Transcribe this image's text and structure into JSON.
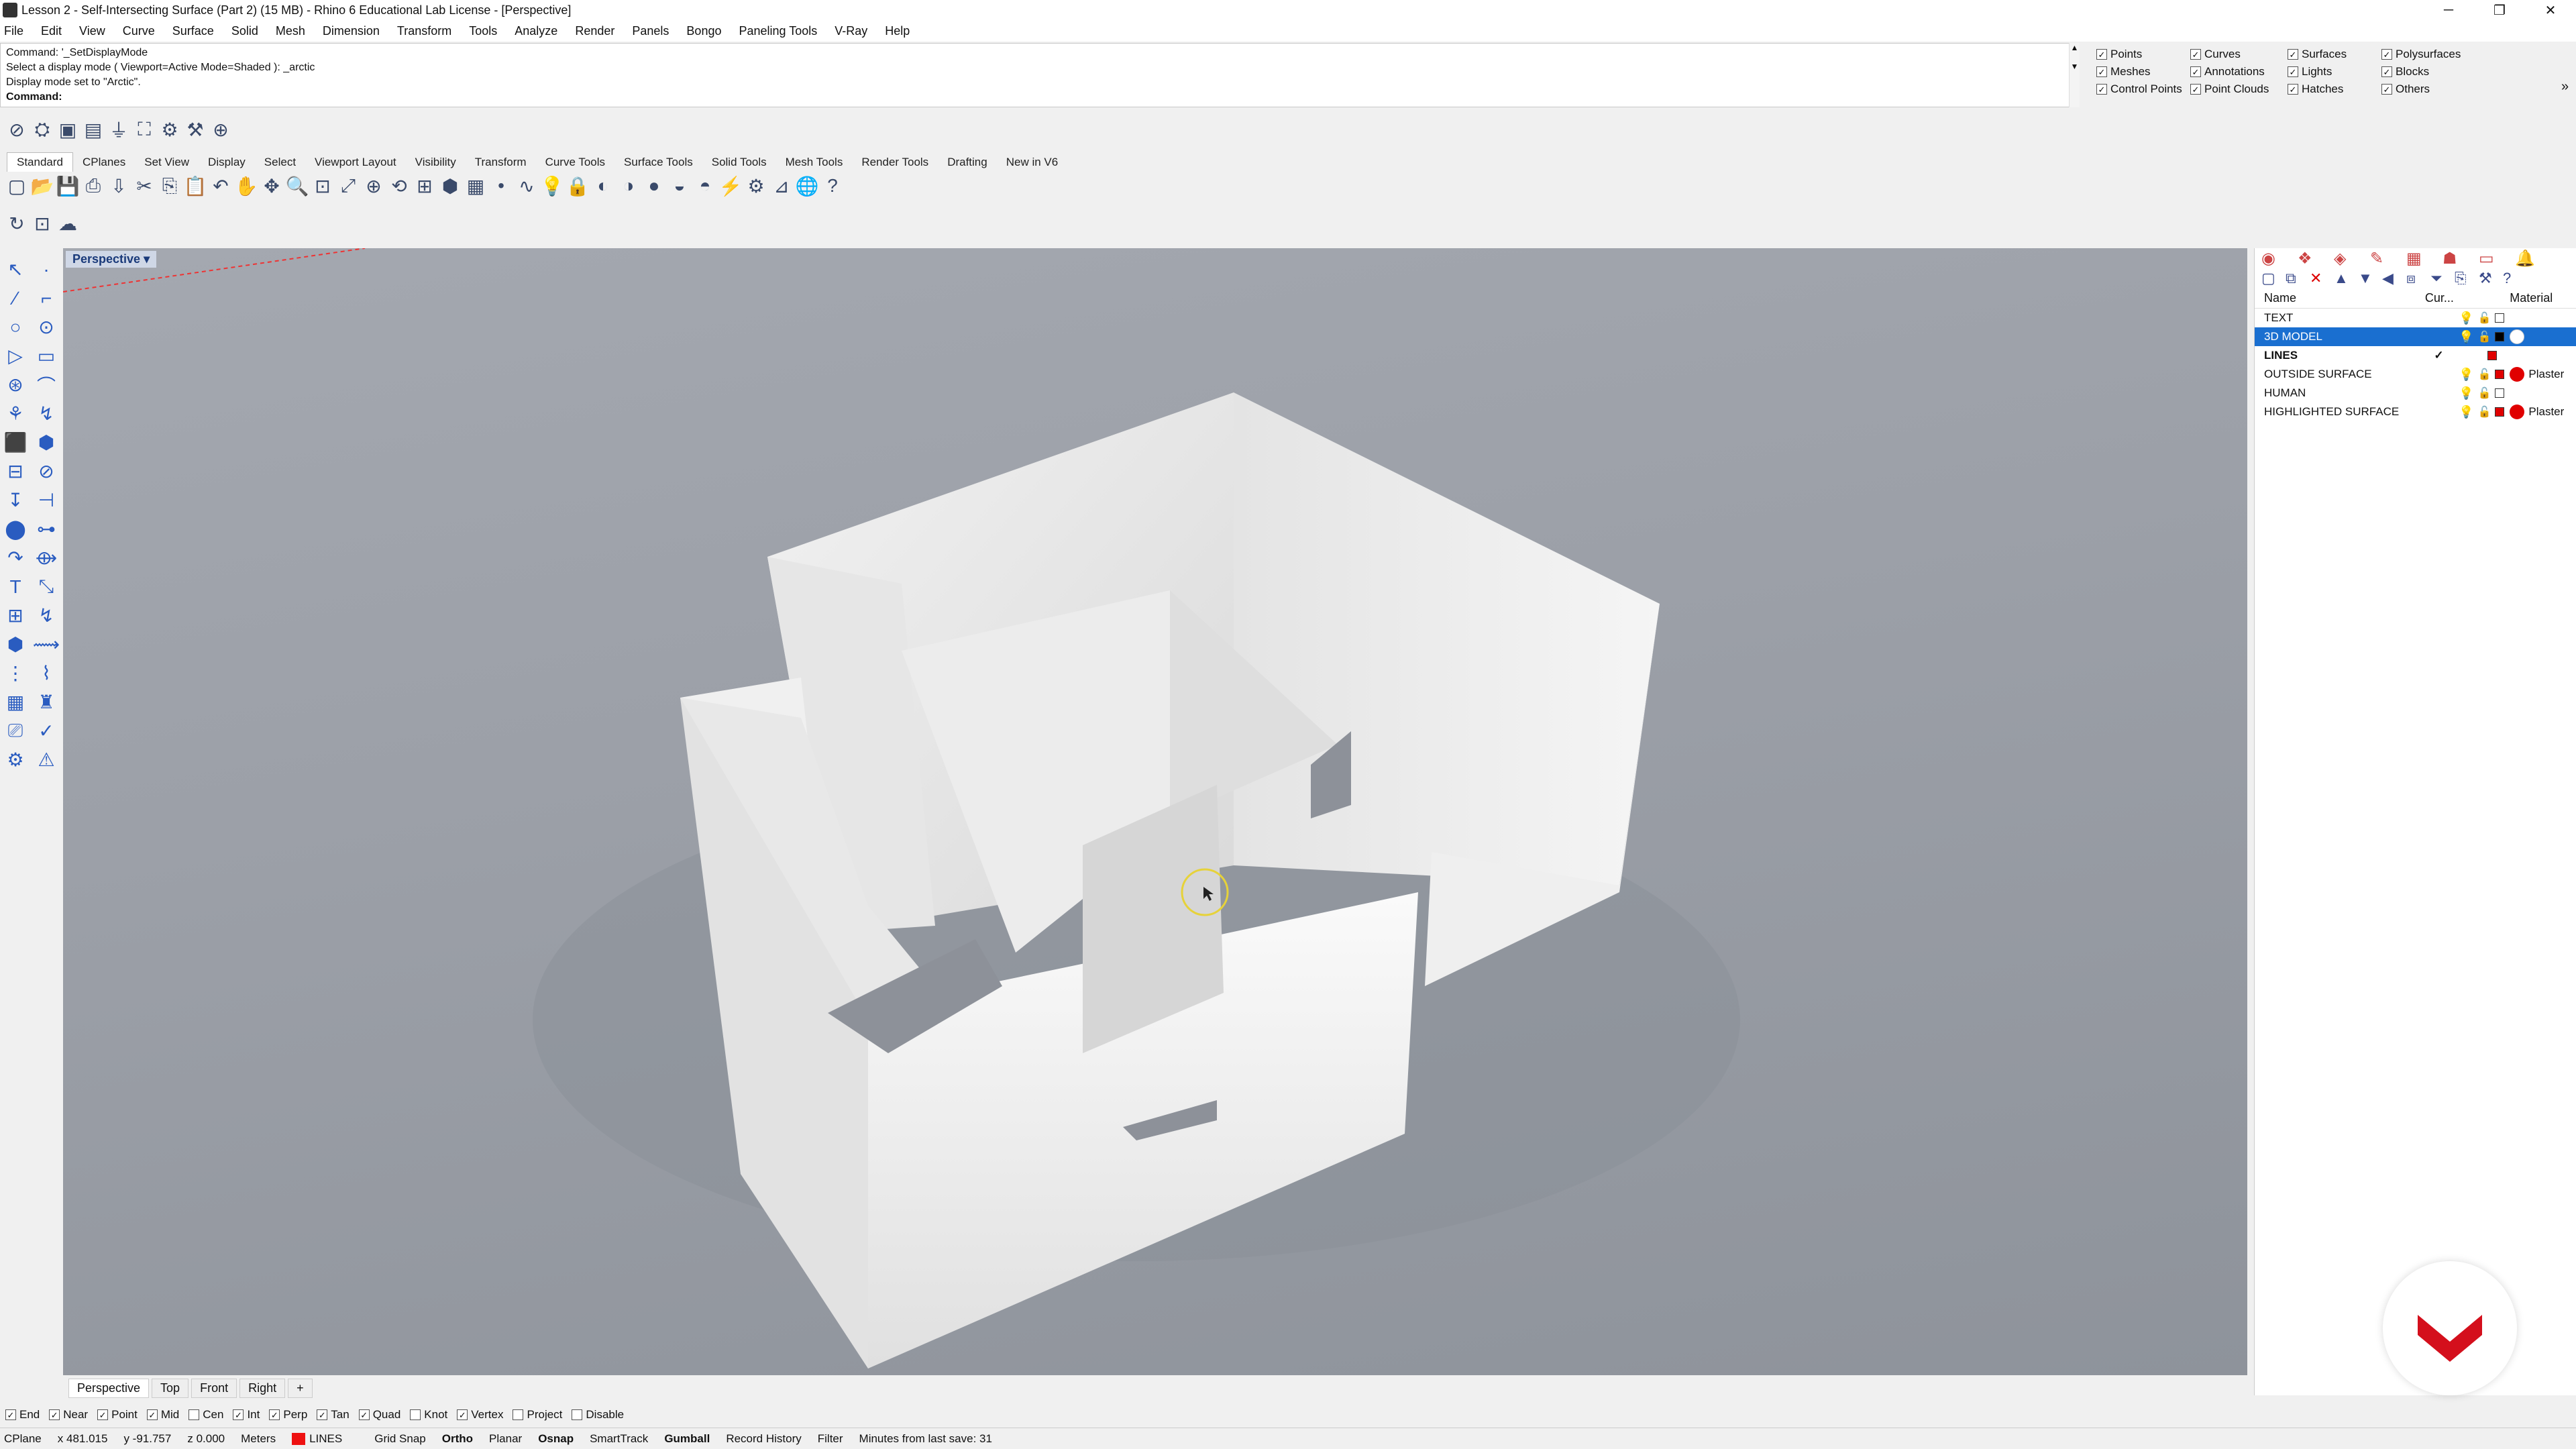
{
  "window": {
    "title": "Lesson 2 - Self-Intersecting Surface (Part 2) (15 MB) - Rhino 6 Educational Lab License - [Perspective]"
  },
  "menu": [
    "File",
    "Edit",
    "View",
    "Curve",
    "Surface",
    "Solid",
    "Mesh",
    "Dimension",
    "Transform",
    "Tools",
    "Analyze",
    "Render",
    "Panels",
    "Bongo",
    "Paneling Tools",
    "V-Ray",
    "Help"
  ],
  "command": {
    "line1": "Command: '_SetDisplayMode",
    "line2": "Select a display mode ( Viewport=Active  Mode=Shaded ): _arctic",
    "line3": "Display mode set to \"Arctic\".",
    "prompt": "Command:"
  },
  "filters": [
    {
      "label": "Points",
      "checked": true
    },
    {
      "label": "Curves",
      "checked": true
    },
    {
      "label": "Surfaces",
      "checked": true
    },
    {
      "label": "Polysurfaces",
      "checked": true
    },
    {
      "label": "Meshes",
      "checked": true
    },
    {
      "label": "Annotations",
      "checked": true
    },
    {
      "label": "Lights",
      "checked": true
    },
    {
      "label": "Blocks",
      "checked": true
    },
    {
      "label": "Control Points",
      "checked": true
    },
    {
      "label": "Point Clouds",
      "checked": true
    },
    {
      "label": "Hatches",
      "checked": true
    },
    {
      "label": "Others",
      "checked": true
    }
  ],
  "tabs": [
    "Standard",
    "CPlanes",
    "Set View",
    "Display",
    "Select",
    "Viewport Layout",
    "Visibility",
    "Transform",
    "Curve Tools",
    "Surface Tools",
    "Solid Tools",
    "Mesh Tools",
    "Render Tools",
    "Drafting",
    "New in V6"
  ],
  "viewport": {
    "title": "Perspective"
  },
  "layers": {
    "headers": {
      "name": "Name",
      "current": "Cur...",
      "material": "Material"
    },
    "rows": [
      {
        "name": "TEXT",
        "current": "",
        "color": "#ffffff",
        "material": "",
        "dot": "",
        "selected": false,
        "bold": false
      },
      {
        "name": "3D MODEL",
        "current": "",
        "color": "#000000",
        "material": "",
        "dot": "#ffffff",
        "selected": true,
        "bold": false
      },
      {
        "name": "LINES",
        "current": "✓",
        "color": "#e00000",
        "material": "",
        "dot": "",
        "selected": false,
        "bold": true
      },
      {
        "name": "OUTSIDE SURFACE",
        "current": "",
        "color": "#e00000",
        "material": "Plaster",
        "dot": "#e00000",
        "selected": false,
        "bold": false
      },
      {
        "name": "HUMAN",
        "current": "",
        "color": "#ffffff",
        "material": "",
        "dot": "",
        "selected": false,
        "bold": false
      },
      {
        "name": "HIGHLIGHTED SURFACE",
        "current": "",
        "color": "#e00000",
        "material": "Plaster",
        "dot": "#e00000",
        "selected": false,
        "bold": false
      }
    ]
  },
  "viewTabs": [
    "Perspective",
    "Top",
    "Front",
    "Right"
  ],
  "osnaps": [
    {
      "label": "End",
      "checked": true
    },
    {
      "label": "Near",
      "checked": true
    },
    {
      "label": "Point",
      "checked": true
    },
    {
      "label": "Mid",
      "checked": true
    },
    {
      "label": "Cen",
      "checked": false
    },
    {
      "label": "Int",
      "checked": true
    },
    {
      "label": "Perp",
      "checked": true
    },
    {
      "label": "Tan",
      "checked": true
    },
    {
      "label": "Quad",
      "checked": true
    },
    {
      "label": "Knot",
      "checked": false
    },
    {
      "label": "Vertex",
      "checked": true
    },
    {
      "label": "Project",
      "checked": false
    },
    {
      "label": "Disable",
      "checked": false
    }
  ],
  "status": {
    "cplane": "CPlane",
    "x": "x 481.015",
    "y": "y -91.757",
    "z": "z 0.000",
    "units": "Meters",
    "layer": "LINES",
    "grid": "Grid Snap",
    "ortho": "Ortho",
    "planar": "Planar",
    "osnap": "Osnap",
    "smarttrack": "SmartTrack",
    "gumball": "Gumball",
    "history": "Record History",
    "filter": "Filter",
    "save": "Minutes from last save: 31"
  },
  "colors": {
    "selection": "#1a6fd0",
    "accent": "#e11",
    "viewportBg": "#9ca0a8"
  }
}
